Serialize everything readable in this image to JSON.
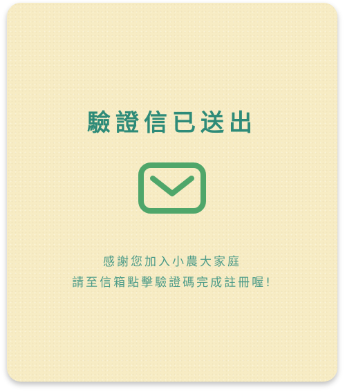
{
  "dialog": {
    "title": "驗證信已送出",
    "icon": "mail-icon",
    "message_line1": "感謝您加入小農大家庭",
    "message_line2": "請至信箱點擊驗證碼完成註冊喔!"
  },
  "colors": {
    "card_background": "#f7ecc4",
    "title": "#2e8b78",
    "icon": "#4fa66a",
    "message": "#4a9a87"
  }
}
